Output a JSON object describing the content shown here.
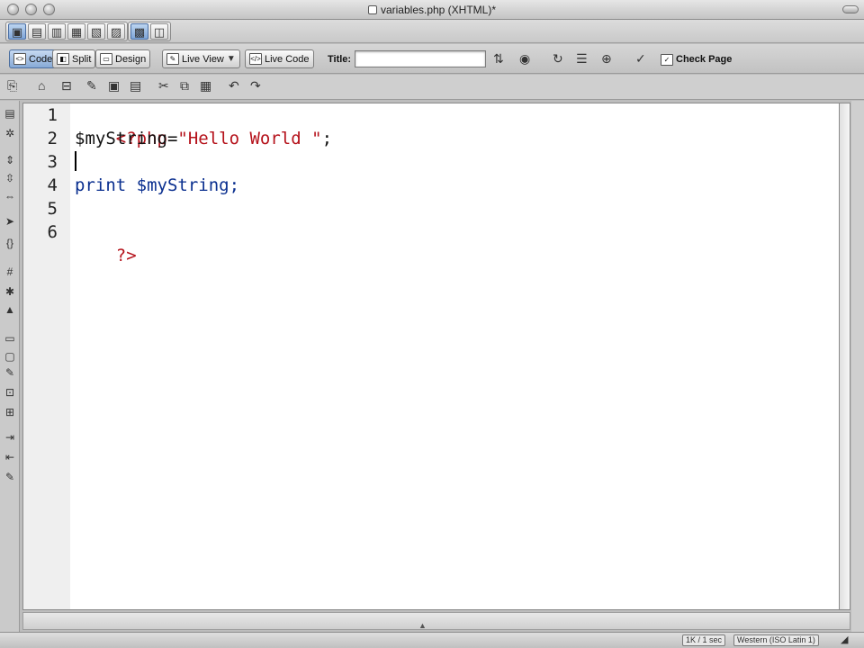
{
  "window": {
    "title": "variables.php (XHTML)*"
  },
  "toolbar": {
    "code_label": "Code",
    "split_label": "Split",
    "design_label": "Design",
    "live_view_label": "Live View",
    "live_code_label": "Live Code",
    "title_label": "Title:",
    "title_value": "",
    "check_page_label": "Check Page"
  },
  "editor": {
    "lines": [
      {
        "num": "1",
        "parts": [
          {
            "text": "<?php",
            "color": "#b5121b"
          }
        ]
      },
      {
        "num": "2",
        "parts": [
          {
            "text": "$myString",
            "color": "#111111"
          },
          {
            "text": "=",
            "color": "#111111"
          },
          {
            "text": "\"Hello World \"",
            "color": "#b5121b"
          },
          {
            "text": ";",
            "color": "#111111"
          }
        ]
      },
      {
        "num": "3",
        "parts": []
      },
      {
        "num": "4",
        "parts": [
          {
            "text": "print",
            "color": "#0a2f8f"
          },
          {
            "text": " $myString;",
            "color": "#0a2f8f"
          }
        ]
      },
      {
        "num": "5",
        "parts": []
      },
      {
        "num": "6",
        "parts": [
          {
            "text": "?>",
            "color": "#b5121b"
          }
        ]
      }
    ],
    "line_num_1": "1",
    "line_num_2": "2",
    "line_num_3": "3",
    "line_num_4": "4",
    "line_num_5": "5",
    "line_num_6": "6",
    "line1_open": "<?php",
    "line2_var": "$myString",
    "line2_eq": "=",
    "line2_str": "\"Hello World \"",
    "line2_semi": ";",
    "line4_kw": "print",
    "line4_rest": " $myString;",
    "line6_close": "?>"
  },
  "status": {
    "size": "1K / 1 sec",
    "encoding": "Western (ISO Latin 1)"
  },
  "colors": {
    "php_tag": "#b5121b",
    "string": "#b5121b",
    "keyword": "#0a2f8f",
    "selection_accent": "#86a9d6"
  },
  "icons": {
    "doc_icon": "document-icon",
    "refresh_icon": "refresh-icon",
    "check_page_icon": "check-page-icon"
  }
}
